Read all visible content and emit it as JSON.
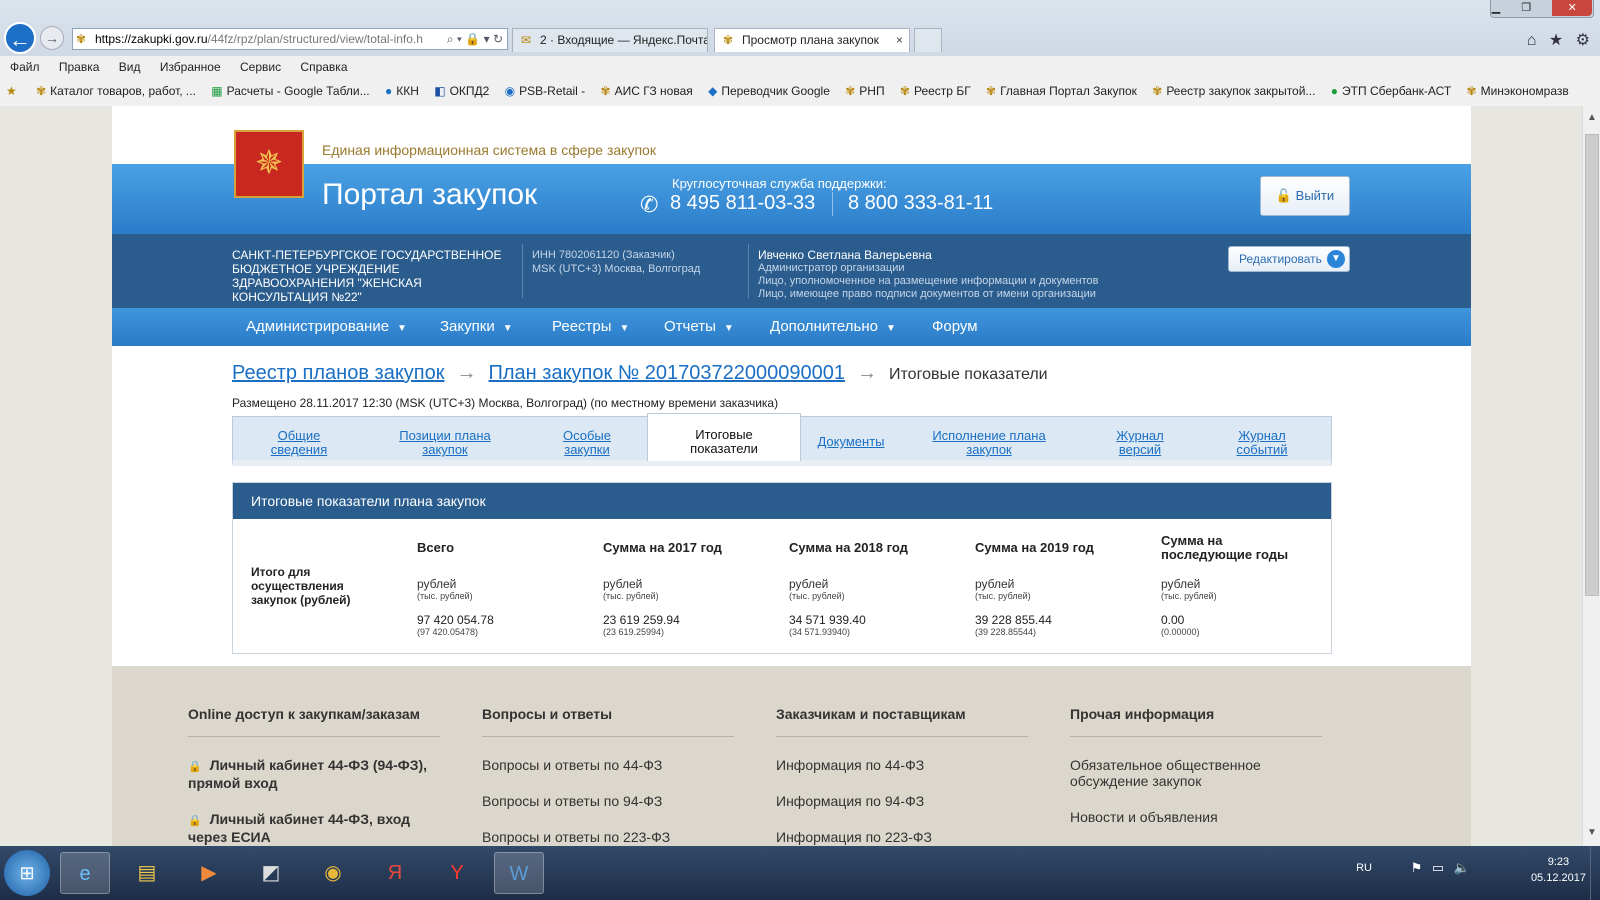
{
  "browser": {
    "url_host": "https://zakupki.gov.ru",
    "url_path": "/44fz/rpz/plan/structured/view/total-info.h",
    "tabs": [
      {
        "title": "2 · Входящие — Яндекс.Почта"
      },
      {
        "title": "Просмотр плана закупок",
        "close": "×"
      }
    ],
    "menu": [
      "Файл",
      "Правка",
      "Вид",
      "Избранное",
      "Сервис",
      "Справка"
    ],
    "favorites": [
      "Каталог товаров, работ, ...",
      "Расчеты - Google Табли...",
      "ККН",
      "ОКПД2",
      "PSB-Retail -",
      "АИС ГЗ новая",
      "Переводчик Google",
      "РНП",
      "Реестр БГ",
      "Главная Портал Закупок",
      "Реестр закупок закрытой...",
      "ЭТП Сбербанк-АСТ",
      "Минэкономразв"
    ]
  },
  "header": {
    "tagline": "Единая информационная система в сфере закупок",
    "title": "Портал закупок",
    "support_label": "Круглосуточная служба поддержки:",
    "phone1": "8 495 811-03-33",
    "phone2": "8 800 333-81-11",
    "logout": "Выйти"
  },
  "org": {
    "name": "САНКТ-ПЕТЕРБУРГСКОЕ ГОСУДАРСТВЕННОЕ БЮДЖЕТНОЕ УЧРЕЖДЕНИЕ ЗДРАВООХРАНЕНИЯ \"ЖЕНСКАЯ КОНСУЛЬТАЦИЯ №22\"",
    "inn": "ИНН 7802061120 (Заказчик)",
    "tz": "MSK (UTC+3) Москва, Волгоград",
    "user": "Ивченко Светлана Валерьевна",
    "role1": "Администратор организации",
    "role2": "Лицо, уполномоченное на размещение информации и документов",
    "role3": "Лицо, имеющее право подписи документов от имени организации",
    "edit": "Редактировать"
  },
  "nav": [
    "Администрирование",
    "Закупки",
    "Реестры",
    "Отчеты",
    "Дополнительно",
    "Форум"
  ],
  "breadcrumb": {
    "root": "Реестр планов закупок",
    "plan": "План закупок № 201703722000090001",
    "current": "Итоговые показатели"
  },
  "posted": "Размещено 28.11.2017 12:30 (MSK (UTC+3) Москва, Волгоград) (по местному времени заказчика)",
  "tabs": [
    {
      "label": "Общие\nсведения"
    },
    {
      "label": "Позиции плана\nзакупок"
    },
    {
      "label": "Особые\nзакупки"
    },
    {
      "label": "Итоговые\nпоказатели"
    },
    {
      "label": "Документы"
    },
    {
      "label": "Исполнение плана\nзакупок"
    },
    {
      "label": "Журнал\nверсий"
    },
    {
      "label": "Журнал\nсобытий"
    }
  ],
  "panel": {
    "title": "Итоговые показатели плана закупок",
    "row_label": "Итого для осуществления закупок (рублей)",
    "unit": "рублей",
    "unit_sub": "(тыс. рублей)",
    "columns": [
      {
        "header": "Всего",
        "value": "97 420 054.78",
        "value_sub": "(97 420.05478)"
      },
      {
        "header": "Сумма на 2017 год",
        "value": "23 619 259.94",
        "value_sub": "(23 619.25994)"
      },
      {
        "header": "Сумма на 2018 год",
        "value": "34 571 939.40",
        "value_sub": "(34 571.93940)"
      },
      {
        "header": "Сумма на 2019 год",
        "value": "39 228 855.44",
        "value_sub": "(39 228.85544)"
      },
      {
        "header": "Сумма на последующие годы",
        "value": "0.00",
        "value_sub": "(0.00000)"
      }
    ]
  },
  "footer": {
    "col1": {
      "title": "Online доступ к закупкам/заказам",
      "links": [
        "Личный кабинет 44-ФЗ (94-ФЗ), прямой вход",
        "Личный кабинет 44-ФЗ, вход через ЕСИА"
      ]
    },
    "col2": {
      "title": "Вопросы и ответы",
      "links": [
        "Вопросы и ответы по 44-ФЗ",
        "Вопросы и ответы по 94-ФЗ",
        "Вопросы и ответы по 223-ФЗ"
      ]
    },
    "col3": {
      "title": "Заказчикам и поставщикам",
      "links": [
        "Информация по 44-ФЗ",
        "Информация по 94-ФЗ",
        "Информация по 223-ФЗ"
      ]
    },
    "col4": {
      "title": "Прочая информация",
      "links": [
        "Обязательное общественное обсуждение закупок",
        "Новости и объявления"
      ]
    }
  },
  "taskbar": {
    "lang": "RU",
    "time": "9:23",
    "date": "05.12.2017"
  }
}
